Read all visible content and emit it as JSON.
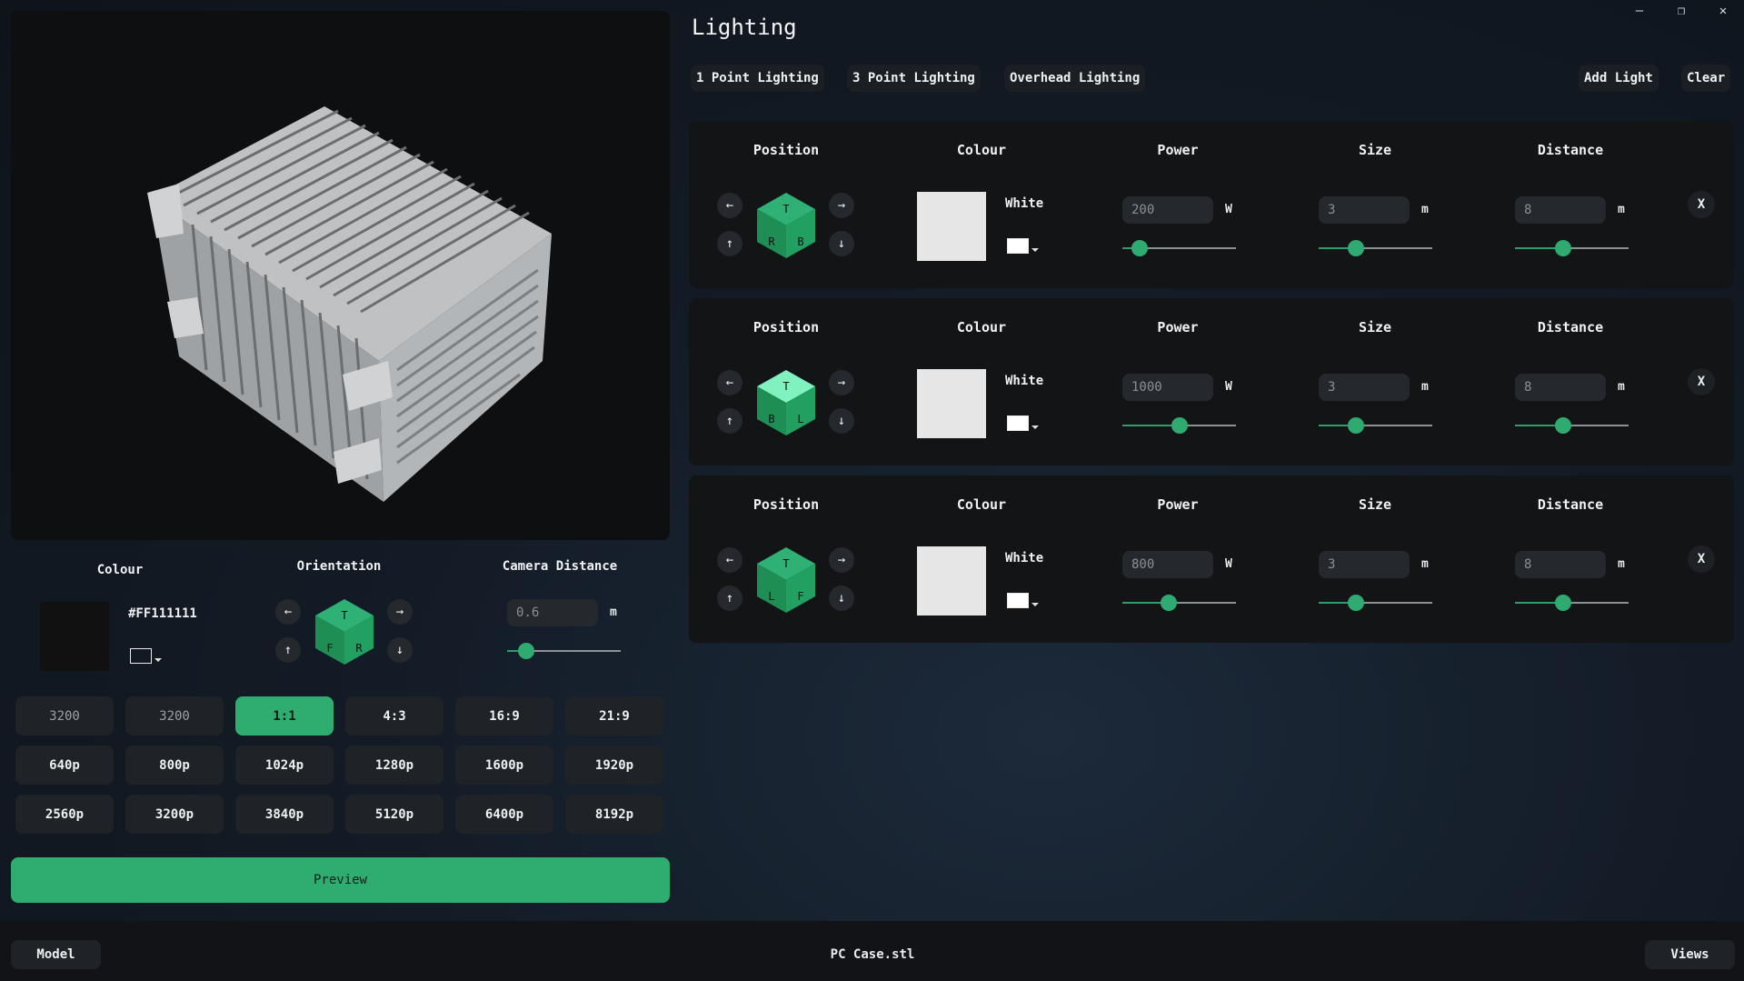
{
  "window_controls": [
    "—",
    "❐",
    "✕"
  ],
  "model_panel": {
    "colour": {
      "label": "Colour",
      "hex": "#FF111111",
      "swatch_color": "#111111"
    },
    "orientation": {
      "label": "Orientation",
      "faces": [
        "T",
        "F",
        "R"
      ]
    },
    "camera": {
      "label": "Camera Distance",
      "value": "0.6",
      "unit": "m",
      "slider_fraction": 0.17
    },
    "resolution_grid": [
      [
        "3200",
        "3200",
        "1:1",
        "4:3",
        "16:9",
        "21:9"
      ],
      [
        "640p",
        "800p",
        "1024p",
        "1280p",
        "1600p",
        "1920p"
      ],
      [
        "2560p",
        "3200p",
        "3840p",
        "5120p",
        "6400p",
        "8192p"
      ]
    ],
    "active_aspect": "1:1",
    "preview_label": "Preview"
  },
  "lighting": {
    "title": "Lighting",
    "presets": [
      "1 Point Lighting",
      "3 Point Lighting",
      "Overhead Lighting"
    ],
    "add_light": "Add Light",
    "clear": "Clear",
    "headers": {
      "position": "Position",
      "colour": "Colour",
      "power": "Power",
      "size": "Size",
      "distance": "Distance"
    },
    "lights": [
      {
        "faces": [
          "T",
          "R",
          "B"
        ],
        "cube_top": "#2fb074",
        "colour_name": "White",
        "power": "200",
        "power_unit": "W",
        "power_frac": 0.15,
        "size": "3",
        "size_unit": "m",
        "size_frac": 0.33,
        "distance": "8",
        "distance_unit": "m",
        "distance_frac": 0.42,
        "remove": "X"
      },
      {
        "faces": [
          "T",
          "B",
          "L"
        ],
        "cube_top": "#7ff2c0",
        "colour_name": "White",
        "power": "1000",
        "power_unit": "W",
        "power_frac": 0.5,
        "size": "3",
        "size_unit": "m",
        "size_frac": 0.33,
        "distance": "8",
        "distance_unit": "m",
        "distance_frac": 0.42,
        "remove": "X"
      },
      {
        "faces": [
          "T",
          "L",
          "F"
        ],
        "cube_top": "#2fb074",
        "colour_name": "White",
        "power": "800",
        "power_unit": "W",
        "power_frac": 0.41,
        "size": "3",
        "size_unit": "m",
        "size_frac": 0.33,
        "distance": "8",
        "distance_unit": "m",
        "distance_frac": 0.42,
        "remove": "X"
      }
    ]
  },
  "statusbar": {
    "model": "Model",
    "filename": "PC Case.stl",
    "views": "Views"
  },
  "arrows": {
    "left": "←",
    "right": "→",
    "up": "↑",
    "down": "↓"
  },
  "colors": {
    "accent": "#2fac70",
    "panel": "#121416",
    "button": "#1f2327"
  }
}
